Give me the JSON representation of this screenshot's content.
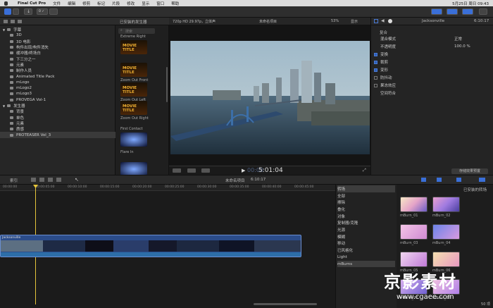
{
  "menubar": {
    "apple": "",
    "app": "Final Cut Pro",
    "items": [
      "文件",
      "编辑",
      "修剪",
      "标记",
      "片段",
      "修改",
      "显示",
      "窗口",
      "帮助"
    ],
    "clock": "5月25日 周日 09:43"
  },
  "toolbar": {
    "key_badge": "0 ✓"
  },
  "libraries": {
    "items": [
      {
        "label": "字幕",
        "level": 0,
        "expand": "▼"
      },
      {
        "label": "3D",
        "level": 1
      },
      {
        "label": "3D 电影",
        "level": 1
      },
      {
        "label": "构件出现/构件消失",
        "level": 1
      },
      {
        "label": "缓冲器/终场白",
        "level": 1
      },
      {
        "label": "下三分之一",
        "level": 1
      },
      {
        "label": "元素",
        "level": 1
      },
      {
        "label": "制作人员",
        "level": 1
      },
      {
        "label": "Animated Title Pack",
        "level": 1
      },
      {
        "label": "mLogo",
        "level": 1
      },
      {
        "label": "mLogo2",
        "level": 1
      },
      {
        "label": "mLogo3",
        "level": 1
      },
      {
        "label": "PROVEGA Vol-1",
        "level": 1
      },
      {
        "label": "发生器",
        "level": 0,
        "expand": "▼"
      },
      {
        "label": "背景",
        "level": 1
      },
      {
        "label": "单色",
        "level": 1
      },
      {
        "label": "元素",
        "level": 1
      },
      {
        "label": "质感",
        "level": 1
      },
      {
        "label": "PROTEASER Vol_3",
        "level": 1,
        "selected": true
      }
    ]
  },
  "browser": {
    "title": "已安装的发生器",
    "search_placeholder": "搜索",
    "clips": [
      {
        "label": "Extreme Right",
        "thumb_text": "MOVIE TITLE"
      },
      {
        "label": "Zoom Out Front",
        "thumb_text": "MOVIE TITLE"
      },
      {
        "label": "Zoom Out Left",
        "thumb_text": "MOVIE TITLE"
      },
      {
        "label": "Zoom Out Right",
        "thumb_text": "MOVIE TITLE"
      },
      {
        "label": "First Contact",
        "thumb_text": ""
      },
      {
        "label": "Flare In",
        "thumb_text": ""
      }
    ]
  },
  "viewer": {
    "format": "720p HD 29.97p，立体声",
    "project": "未命名项目",
    "zoom": "53%",
    "view": "显示",
    "timecode": "5:01:04",
    "timecode_prefix": "00:00"
  },
  "inspector": {
    "title": "Jacksonville",
    "duration": "6:10:17",
    "section": "复合",
    "rows": [
      {
        "label": "混合模式",
        "value": "正常",
        "checkbox": null
      },
      {
        "label": "不透明度",
        "value": "100.0 %",
        "checkbox": null
      },
      {
        "label": "变换",
        "value": "",
        "checkbox": true
      },
      {
        "label": "裁剪",
        "value": "",
        "checkbox": true
      },
      {
        "label": "变形",
        "value": "",
        "checkbox": true
      },
      {
        "label": "防抖动",
        "value": "",
        "checkbox": false
      },
      {
        "label": "果冻效应",
        "value": "",
        "checkbox": false
      },
      {
        "label": "空间符合",
        "value": "",
        "checkbox": null
      }
    ],
    "save_button": "存储效果预置"
  },
  "timeline_bar": {
    "index_label": "索引",
    "project": "未命名项目",
    "duration": "6:10:17",
    "effects_title": "已安装的转场"
  },
  "ruler": [
    "00:00:00",
    "00:00:05:00",
    "00:00:10:00",
    "00:00:15:00",
    "00:00:20:00",
    "00:00:25:00",
    "00:00:30:00",
    "00:00:35:00",
    "00:00:40:00",
    "00:00:45:00"
  ],
  "clip": {
    "name": "Jacksonville"
  },
  "fx_list": {
    "items": [
      {
        "label": "转场",
        "selected": true
      },
      {
        "label": "全部"
      },
      {
        "label": "擦除"
      },
      {
        "label": "叠化"
      },
      {
        "label": "对象"
      },
      {
        "label": "复制器/克隆"
      },
      {
        "label": "光源"
      },
      {
        "label": "模糊"
      },
      {
        "label": "移动"
      },
      {
        "label": "已风格化"
      },
      {
        "label": "Light"
      },
      {
        "label": "mBurns",
        "selected": true
      }
    ]
  },
  "fx_grid": {
    "items": [
      {
        "label": "mBurn_01"
      },
      {
        "label": "mBurn_02"
      },
      {
        "label": "mBurn_03"
      },
      {
        "label": "mBurn_04"
      },
      {
        "label": "mBurn_05"
      },
      {
        "label": "mBurn_06"
      },
      {
        "label": "mBurn_07"
      },
      {
        "label": "mBurn_08"
      }
    ],
    "count": "50 项"
  },
  "watermark": {
    "cn": "京影素材",
    "url": "www.cgaee.com"
  }
}
